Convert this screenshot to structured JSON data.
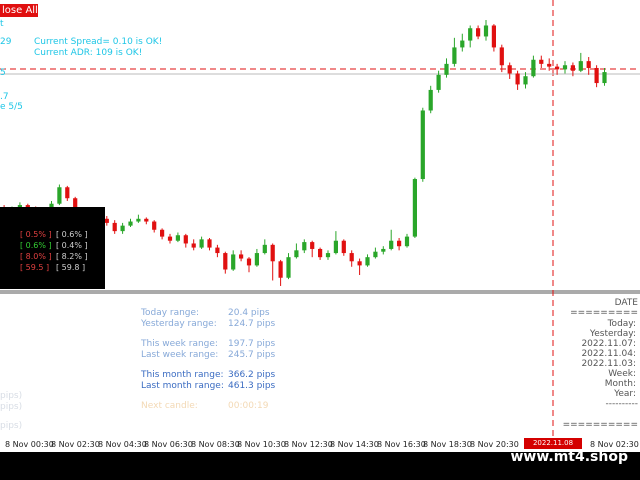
{
  "buttons": {
    "close_all": "lose All"
  },
  "top_info": {
    "left_values": [
      "29",
      "t",
      "5",
      ".7",
      "e 5/5"
    ],
    "spread": "Current Spread= 0.10 is OK!",
    "adr": "Current ADR: 109  is OK!"
  },
  "colors": {
    "bull": "#2aa62a",
    "bear": "#e01010",
    "dashed": "#e01010",
    "cyan": "#1ec6e6"
  },
  "stats_panel": {
    "rows": [
      {
        "a": "[ 0.5% ]",
        "b": "[ 0.6% ]",
        "a_color": "#e04040",
        "b_color": "#cfcfcf"
      },
      {
        "a": "[ 0.6% ]",
        "b": "[ 0.4% ]",
        "a_color": "#33cc33",
        "b_color": "#cfcfcf"
      },
      {
        "a": "[ 8.0% ]",
        "b": "[ 8.2% ]",
        "a_color": "#e04040",
        "b_color": "#cfcfcf"
      },
      {
        "a": "[ 59.5 ]",
        "b": "[ 59.8 ]",
        "a_color": "#e04040",
        "b_color": "#cfcfcf"
      }
    ]
  },
  "ranges": {
    "today_label": "Today range:",
    "today_value": "20.4 pips",
    "yesterday_label": "Yesterday range:",
    "yesterday_value": "124.7 pips",
    "this_week_label": "This week range:",
    "this_week_value": "197.7 pips",
    "last_week_label": "Last week range:",
    "last_week_value": "245.7 pips",
    "this_month_label": "This month range:",
    "this_month_value": "366.2 pips",
    "last_month_label": "Last month range:",
    "last_month_value": "461.3 pips",
    "next_candle_label": "Next candle:",
    "next_candle_value": "00:00:19"
  },
  "right_panel": {
    "title": "DATE",
    "line1": "=========",
    "today": "Today:",
    "yesterday": "Yesterday:",
    "d1": "2022.11.07:",
    "d2": "2022.11.04:",
    "d3": "2022.11.03:",
    "week": "Week:",
    "month": "Month:",
    "year": "Year:",
    "line2": "----------",
    "line3": "=========="
  },
  "left_fragments": [
    "pips)",
    "pips)",
    "pips)"
  ],
  "time_axis": {
    "ticks": [
      "8 Nov 00:30",
      "8 Nov 02:30",
      "8 Nov 04:30",
      "8 Nov 06:30",
      "8 Nov 08:30",
      "8 Nov 10:30",
      "8 Nov 12:30",
      "8 Nov 14:30",
      "8 Nov 16:30",
      "8 Nov 18:30",
      "8 Nov 20:30",
      "8 Nov 02:30"
    ],
    "current_time": "2022.11.08 00:00"
  },
  "watermark": "www.mt4.shop",
  "candles": [
    [
      97.9,
      97.6,
      98.1,
      97.5
    ],
    [
      97.6,
      97.9,
      98.0,
      97.4
    ],
    [
      97.9,
      98.1,
      98.3,
      97.8
    ],
    [
      98.1,
      97.8,
      98.2,
      97.6
    ],
    [
      97.8,
      97.5,
      98.0,
      97.3
    ],
    [
      97.5,
      97.8,
      97.9,
      97.4
    ],
    [
      97.8,
      98.2,
      98.4,
      97.7
    ],
    [
      98.2,
      99.4,
      99.6,
      98.1
    ],
    [
      99.4,
      98.6,
      99.5,
      98.4
    ],
    [
      98.6,
      97.6,
      98.7,
      97.4
    ],
    [
      97.6,
      97.2,
      97.8,
      96.9
    ],
    [
      97.2,
      97.5,
      97.7,
      97.0
    ],
    [
      97.5,
      97.1,
      97.6,
      96.8
    ],
    [
      97.1,
      96.8,
      97.3,
      96.6
    ],
    [
      96.8,
      96.2,
      97.0,
      96.0
    ],
    [
      96.2,
      96.6,
      96.8,
      96.0
    ],
    [
      96.6,
      96.9,
      97.1,
      96.5
    ],
    [
      96.9,
      97.1,
      97.4,
      96.8
    ],
    [
      97.1,
      96.9,
      97.2,
      96.7
    ],
    [
      96.9,
      96.3,
      97.0,
      96.1
    ],
    [
      96.3,
      95.8,
      96.4,
      95.6
    ],
    [
      95.8,
      95.5,
      96.0,
      95.3
    ],
    [
      95.5,
      95.9,
      96.1,
      95.4
    ],
    [
      95.9,
      95.3,
      96.0,
      95.0
    ],
    [
      95.3,
      95.0,
      95.6,
      94.8
    ],
    [
      95.0,
      95.6,
      95.8,
      94.9
    ],
    [
      95.6,
      95.0,
      95.7,
      94.8
    ],
    [
      95.0,
      94.6,
      95.2,
      94.3
    ],
    [
      94.6,
      93.4,
      94.7,
      93.1
    ],
    [
      93.4,
      94.5,
      94.8,
      93.3
    ],
    [
      94.5,
      94.2,
      94.8,
      94.0
    ],
    [
      94.2,
      93.7,
      94.3,
      93.2
    ],
    [
      93.7,
      94.6,
      94.9,
      93.6
    ],
    [
      94.6,
      95.2,
      95.6,
      94.5
    ],
    [
      95.2,
      94.0,
      95.3,
      92.6
    ],
    [
      94.0,
      92.8,
      94.1,
      92.2
    ],
    [
      92.8,
      94.3,
      94.6,
      92.7
    ],
    [
      94.3,
      94.8,
      95.3,
      94.2
    ],
    [
      94.8,
      95.4,
      95.6,
      94.6
    ],
    [
      95.4,
      94.9,
      95.5,
      94.3
    ],
    [
      94.9,
      94.3,
      95.0,
      94.1
    ],
    [
      94.3,
      94.6,
      94.8,
      94.1
    ],
    [
      94.6,
      95.5,
      96.2,
      94.5
    ],
    [
      95.5,
      94.6,
      95.6,
      94.4
    ],
    [
      94.6,
      94.0,
      94.8,
      93.6
    ],
    [
      94.0,
      93.7,
      94.2,
      93.0
    ],
    [
      93.7,
      94.3,
      94.5,
      93.6
    ],
    [
      94.3,
      94.7,
      95.0,
      94.2
    ],
    [
      94.7,
      94.9,
      95.1,
      94.5
    ],
    [
      94.9,
      95.5,
      96.3,
      94.8
    ],
    [
      95.5,
      95.1,
      95.7,
      94.8
    ],
    [
      95.1,
      95.8,
      96.0,
      95.0
    ],
    [
      95.8,
      100.0,
      100.1,
      95.7
    ],
    [
      100.0,
      105.0,
      105.2,
      99.8
    ],
    [
      105.0,
      106.5,
      106.8,
      104.8
    ],
    [
      106.5,
      107.6,
      107.9,
      106.3
    ],
    [
      107.6,
      108.4,
      108.8,
      107.4
    ],
    [
      108.4,
      109.6,
      110.3,
      108.2
    ],
    [
      109.6,
      110.1,
      110.6,
      109.3
    ],
    [
      110.1,
      111.0,
      111.2,
      109.6
    ],
    [
      111.0,
      110.4,
      111.2,
      110.2
    ],
    [
      110.4,
      111.2,
      111.6,
      110.1
    ],
    [
      111.2,
      109.6,
      111.3,
      109.3
    ],
    [
      109.6,
      108.3,
      109.8,
      107.8
    ],
    [
      108.3,
      107.7,
      108.5,
      107.3
    ],
    [
      107.7,
      106.9,
      107.9,
      106.5
    ],
    [
      106.9,
      107.5,
      107.8,
      106.6
    ],
    [
      107.5,
      108.7,
      109.0,
      107.4
    ],
    [
      108.7,
      108.4,
      109.0,
      108.1
    ],
    [
      108.4,
      108.2,
      108.8,
      107.9
    ],
    [
      108.2,
      108.0,
      108.4,
      107.6
    ],
    [
      108.0,
      108.3,
      108.6,
      107.7
    ],
    [
      108.3,
      107.9,
      108.5,
      107.5
    ],
    [
      107.9,
      108.6,
      109.2,
      107.8
    ],
    [
      108.6,
      108.1,
      108.9,
      107.6
    ],
    [
      108.1,
      107.0,
      108.3,
      106.7
    ],
    [
      107.0,
      107.8,
      108.1,
      106.8
    ]
  ]
}
